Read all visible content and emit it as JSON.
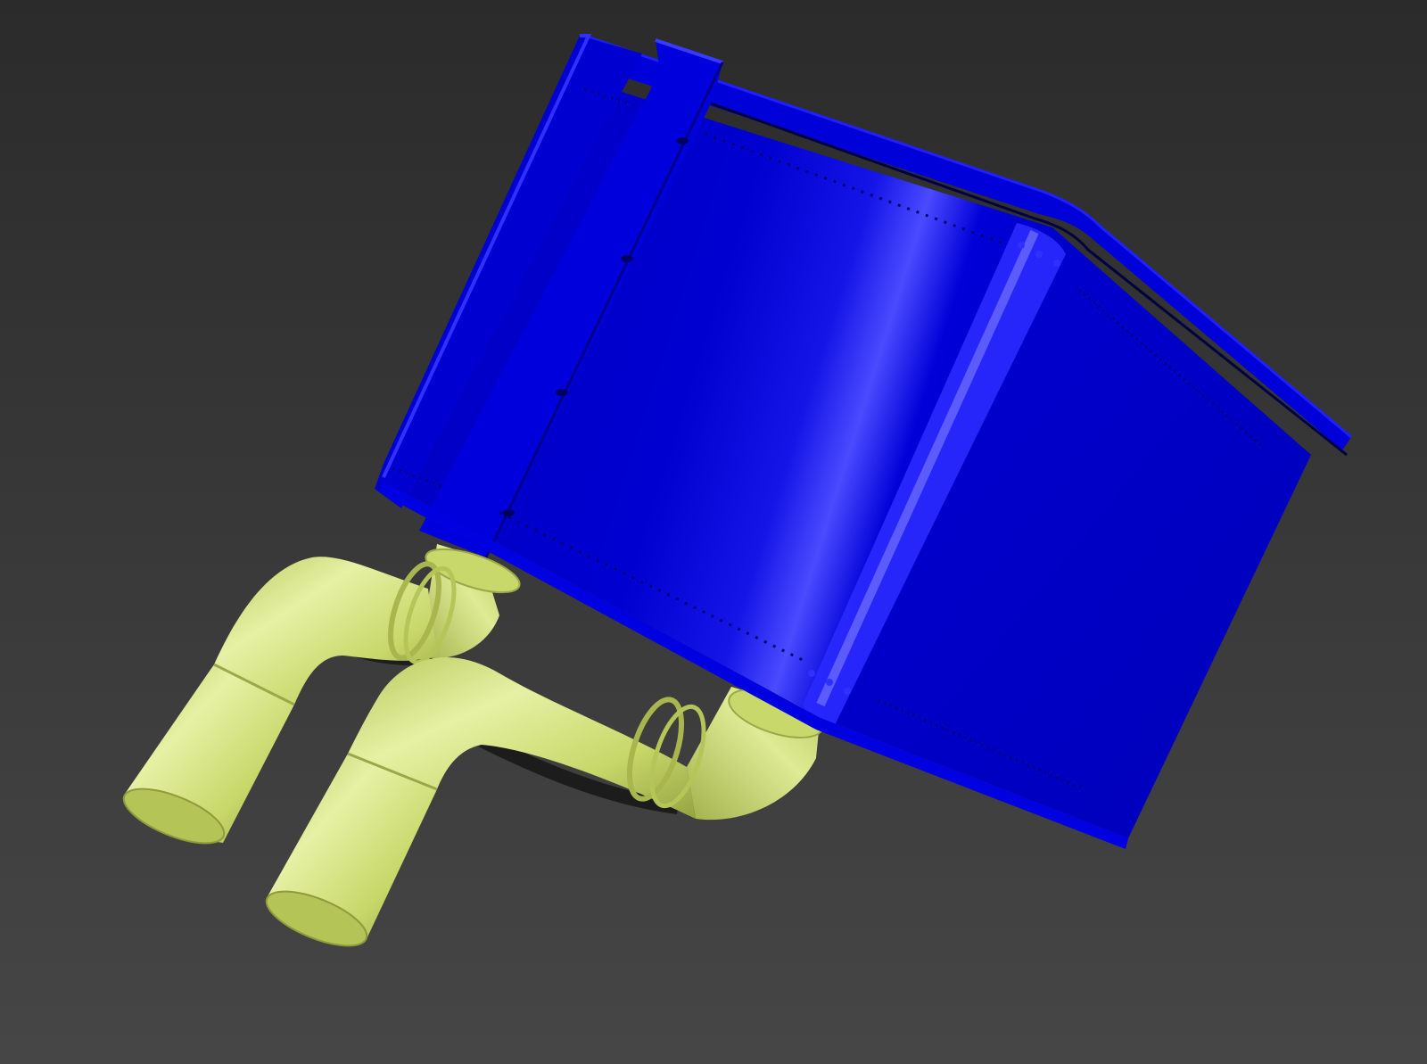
{
  "scene": {
    "background_top": "#2b2b2b",
    "background_bottom": "#464646",
    "box_color": "#0000cc",
    "box_highlight": "#4d4dff",
    "box_shadow": "#00008a",
    "pipe_color": "#c8d86a",
    "pipe_highlight": "#e4efa0",
    "pipe_shadow": "#8e9a3c"
  }
}
